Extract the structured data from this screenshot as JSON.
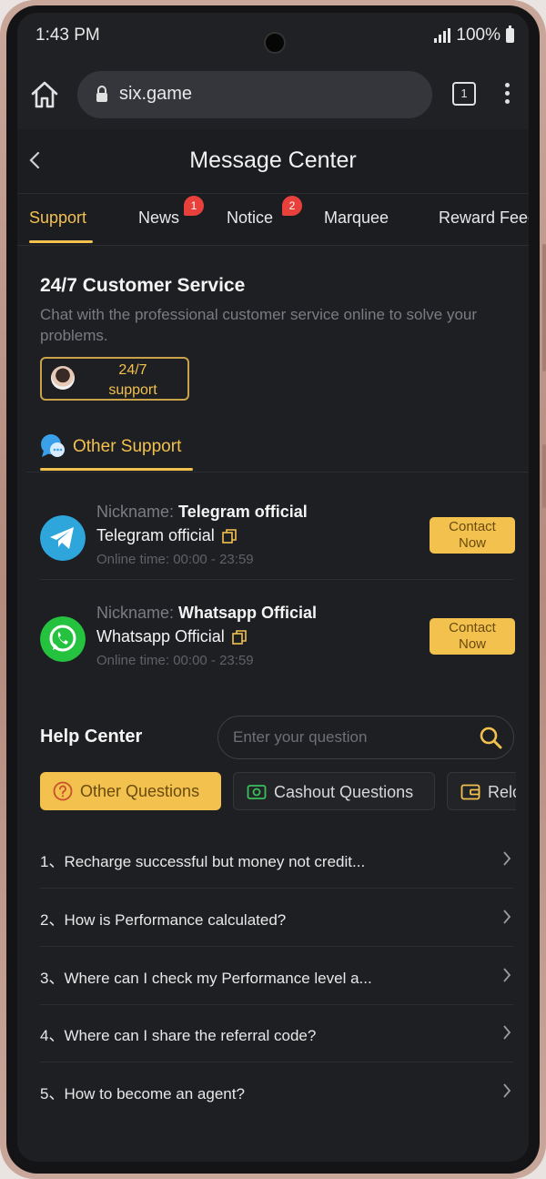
{
  "status": {
    "time": "1:43 PM",
    "battery": "100%"
  },
  "browser": {
    "url": "six.game",
    "tab_count": "1"
  },
  "header": {
    "title": "Message Center"
  },
  "tabs": [
    {
      "label": "Support",
      "badge": ""
    },
    {
      "label": "News",
      "badge": "1"
    },
    {
      "label": "Notice",
      "badge": "2"
    },
    {
      "label": "Marquee",
      "badge": ""
    },
    {
      "label": "Reward Feed",
      "badge": ""
    }
  ],
  "customer_service": {
    "title": "24/7 Customer Service",
    "description": "Chat with the professional customer service online to solve your problems.",
    "button_line1": "24/7",
    "button_line2": "support"
  },
  "other_support": {
    "label": "Other Support",
    "nickname_prefix": "Nickname:",
    "online_prefix": "Online time:",
    "contact_label_1": "Contact",
    "contact_label_2": "Now",
    "contacts": [
      {
        "nickname": "Telegram official",
        "name": "Telegram official",
        "online": "00:00 - 23:59",
        "icon": "telegram-icon",
        "color": "#2ea6dc"
      },
      {
        "nickname": "Whatsapp Official",
        "name": "Whatsapp Official",
        "online": "00:00 - 23:59",
        "icon": "whatsapp-icon",
        "color": "#25c23f"
      }
    ]
  },
  "help_center": {
    "title": "Help Center",
    "search_placeholder": "Enter your question",
    "categories": [
      {
        "label": "Other Questions",
        "icon": "question-icon"
      },
      {
        "label": "Cashout Questions",
        "icon": "cashout-icon"
      },
      {
        "label": "Relc",
        "icon": "wallet-icon"
      }
    ],
    "questions": [
      "1、Recharge successful but money not credit...",
      "2、How is Performance calculated?",
      "3、Where can I check my Performance level a...",
      "4、Where can I share the referral code?",
      "5、How to become an agent?"
    ]
  },
  "colors": {
    "accent": "#f2c14e",
    "badge": "#e8413b",
    "background": "#1e1f23"
  }
}
